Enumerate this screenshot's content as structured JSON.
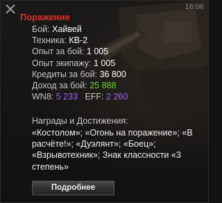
{
  "header": {
    "time": "16:06",
    "close_icon": "close-icon"
  },
  "result": {
    "title": "Поражение",
    "color": "#e2322a"
  },
  "stats": {
    "battle_label": "Бой:",
    "battle_value": "Хайвей",
    "tank_label": "Техника:",
    "tank_value": "КВ-2",
    "exp_label": "Опыт за бой:",
    "exp_value": "1 005",
    "crew_exp_label": "Опыт экипажу:",
    "crew_exp_value": "1 005",
    "credits_label": "Кредиты за бой:",
    "credits_value": "36 800",
    "income_label": "Доход за бой:",
    "income_value": "25 888",
    "wn8_label": "WN8:",
    "wn8_value": "5 233",
    "eff_label": "EFF:",
    "eff_value": "2 260"
  },
  "awards": {
    "title": "Награды и Достижения:",
    "text": "«Костолом»; «Огонь на поражение»; «В расчёте!»; «Дуэлянт»; «Боец»; «Взрывотехник»; Знак классности «3 степень»"
  },
  "actions": {
    "details_label": "Подробнее"
  },
  "colors": {
    "accent_red": "#e2322a",
    "green": "#6fd23a",
    "purple": "#a060ff"
  }
}
